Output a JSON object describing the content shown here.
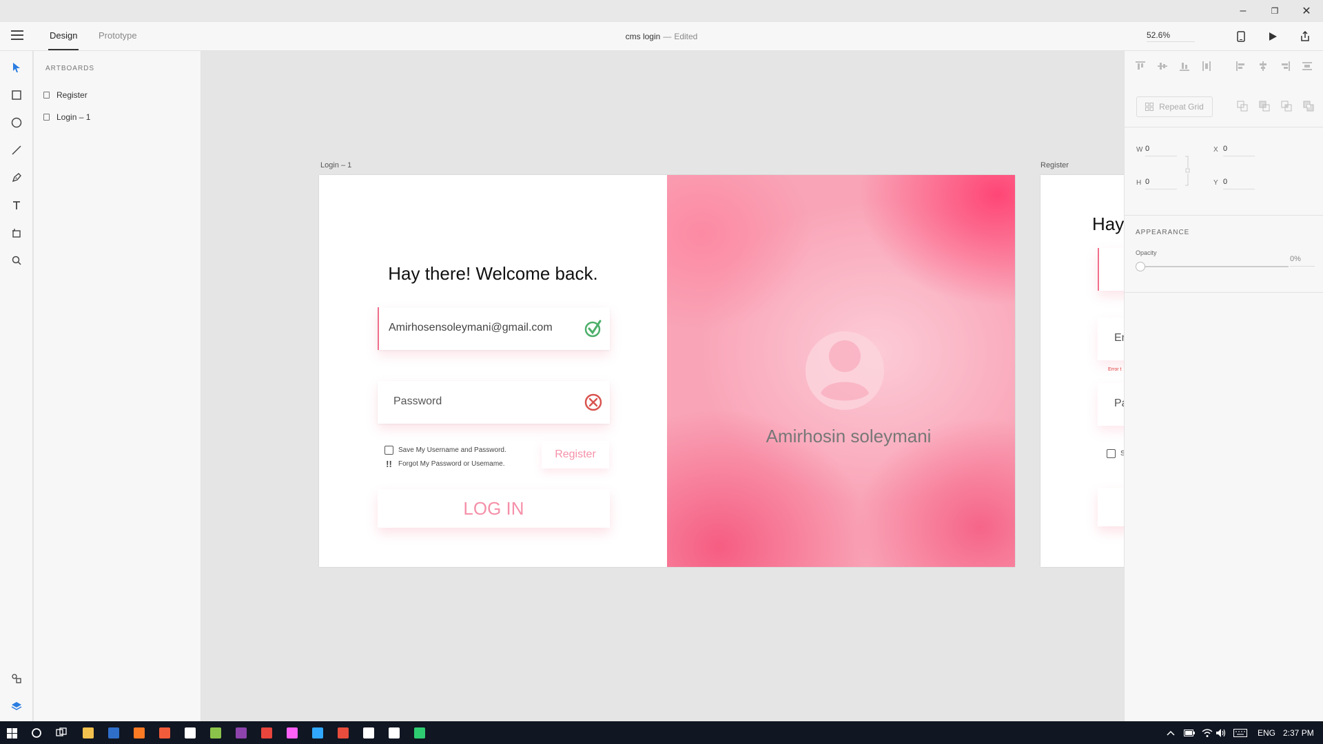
{
  "window": {
    "minimize_glyph": "–",
    "restore_glyph": "❐",
    "close_glyph": "✕"
  },
  "toolbar": {
    "tabs": [
      {
        "label": "Design",
        "active": true
      },
      {
        "label": "Prototype",
        "active": false
      }
    ],
    "document_name": "cms login",
    "separator": "—",
    "status": "Edited",
    "zoom": "52.6%"
  },
  "artboards_panel": {
    "heading": "ARTBOARDS",
    "items": [
      {
        "label": "Register"
      },
      {
        "label": "Login – 1"
      }
    ]
  },
  "canvas": {
    "login_artboard": {
      "label": "Login – 1",
      "welcome": "Hay there! Welcome back.",
      "email_value": "Amirhosensoleymani@gmail.com",
      "email_status_icon": "check-circle-icon",
      "password_placeholder": "Password",
      "password_status_icon": "error-x-icon",
      "save_label": "Save My Username and Password.",
      "forgot_mark": "!!",
      "forgot_label": "Forgot My Password or Usemame.",
      "register_label": "Register",
      "login_label": "LOG IN",
      "profile_name": "Amirhosin soleymani",
      "accent_color": "#f06e8c",
      "hero_color": "#f9a4b7"
    },
    "register_artboard": {
      "label": "Register",
      "heading_fragment": "Hay",
      "field1_fragment": "Er",
      "error_fragment": "Error t",
      "field2_fragment": "Pa",
      "check_fragment": "S"
    }
  },
  "properties": {
    "repeat_grid_label": "Repeat Grid",
    "w_label": "W",
    "w_value": "0",
    "h_label": "H",
    "h_value": "0",
    "x_label": "X",
    "x_value": "0",
    "y_label": "Y",
    "y_value": "0",
    "appearance_heading": "APPEARANCE",
    "opacity_label": "Opacity",
    "opacity_value": "0%"
  },
  "taskbar": {
    "language": "ENG",
    "time": "2:37 PM",
    "apps": [
      {
        "name": "file-explorer",
        "color": "#f2c14e"
      },
      {
        "name": "powershell",
        "color": "#2f6fc9"
      },
      {
        "name": "xampp",
        "color": "#fb7a24"
      },
      {
        "name": "app-orange",
        "color": "#f35c3a"
      },
      {
        "name": "app-white",
        "color": "#ffffff"
      },
      {
        "name": "app-diamond",
        "color": "#8bc34a"
      },
      {
        "name": "app-purple",
        "color": "#8e44ad"
      },
      {
        "name": "chrome",
        "color": "#e8453c"
      },
      {
        "name": "adobe-xd",
        "color": "#ff61f6"
      },
      {
        "name": "photoshop",
        "color": "#31a8ff"
      },
      {
        "name": "app-stripes",
        "color": "#e74c3c"
      },
      {
        "name": "app-circle",
        "color": "#ffffff"
      },
      {
        "name": "calculator",
        "color": "#ffffff"
      },
      {
        "name": "app-green",
        "color": "#2ecc71"
      }
    ]
  }
}
